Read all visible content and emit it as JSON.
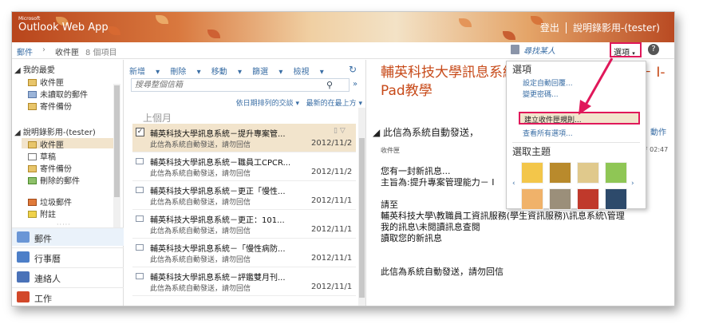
{
  "app": {
    "brand_small": "Microsoft",
    "brand_name": "Outlook Web App",
    "signout": "登出",
    "user": "說明錄影用-(tester)"
  },
  "crumbs": {
    "mail": "郵件",
    "inbox": "收件匣",
    "count": "8 個項目"
  },
  "header_links": {
    "find_people": "尋找某人",
    "options": "選項",
    "help": "?"
  },
  "leftnav": {
    "favorites_header": "我的最愛",
    "favorites": [
      {
        "label": "收件匣",
        "icon": "inbox-icon"
      },
      {
        "label": "未讀取的郵件",
        "icon": "search-folder-icon"
      },
      {
        "label": "寄件備份",
        "icon": "sent-icon"
      }
    ],
    "mailbox_header": "說明錄影用-(tester)",
    "mailbox": [
      {
        "label": "收件匣",
        "icon": "inbox-icon"
      },
      {
        "label": "草稿",
        "icon": "drafts-icon"
      },
      {
        "label": "寄件備份",
        "icon": "sent-icon"
      },
      {
        "label": "刪除的郵件",
        "icon": "trash-icon"
      },
      {
        "label": "垃圾郵件",
        "icon": "junk-icon"
      },
      {
        "label": "附註",
        "icon": "notes-icon"
      }
    ],
    "modules": [
      {
        "label": "郵件",
        "icon": "mail-icon",
        "color": "#6a96d6"
      },
      {
        "label": "行事曆",
        "icon": "calendar-icon",
        "color": "#4d7fc8"
      },
      {
        "label": "連絡人",
        "icon": "contacts-icon",
        "color": "#4a72b8"
      },
      {
        "label": "工作",
        "icon": "tasks-icon",
        "color": "#d2482a"
      }
    ]
  },
  "toolbar": {
    "new": "新增",
    "delete": "刪除",
    "move": "移動",
    "filter": "篩選",
    "view": "檢視"
  },
  "search": {
    "placeholder": "搜尋整個信箱"
  },
  "sort": {
    "by": "依日期排列的交談",
    "order": "最新的在最上方"
  },
  "list_group": "上個月",
  "messages": [
    {
      "subject": "輔英科技大學訊息系統－提升專案管...",
      "preview": "此信為系統自動發送，請勿回信",
      "date": "2012/11/2",
      "selected": true
    },
    {
      "subject": "輔英科技大學訊息系統－職員工CPCR...",
      "preview": "此信為系統自動發送，請勿回信",
      "date": "2012/11/2",
      "selected": false
    },
    {
      "subject": "輔英科技大學訊息系統－更正「慢性...",
      "preview": "此信為系統自動發送，請勿回信",
      "date": "2012/11/1",
      "selected": false
    },
    {
      "subject": "輔英科技大學訊息系統－更正：101...",
      "preview": "此信為系統自動發送，請勿回信",
      "date": "2012/11/1",
      "selected": false
    },
    {
      "subject": "輔英科技大學訊息系統－「慢性病防...",
      "preview": "此信為系統自動發送，請勿回信",
      "date": "2012/11/1",
      "selected": false
    },
    {
      "subject": "輔英科技大學訊息系統－評鑑雙月刊...",
      "preview": "此信為系統自動發送，請勿回信",
      "date": "2012/11/1",
      "selected": false
    }
  ],
  "reading": {
    "title": "輔英科技大學訊息系統－提升專案管理能力－ I-Pad教學",
    "subject": "此信為系統自動發送，",
    "actions": "動作",
    "to": "收件匣",
    "time": "F 02:47",
    "body": [
      "您有一封新訊息...",
      "主旨為:提升專案管理能力－ I",
      "",
      "請至",
      "輔英科技大學\\教職員工資訊服務(學生資訊服務)\\訊息系統\\管理",
      "我的訊息\\未閱讀訊息查閱",
      "讀取您的新訊息",
      "",
      "",
      "此信為系統自動發送，請勿回信"
    ]
  },
  "options_menu": {
    "header": "選項",
    "items": [
      "設定自動回覆...",
      "變更密碼...",
      "建立收件匣規則...",
      "查看所有選項..."
    ],
    "theme_header": "選取主題",
    "themes": [
      {
        "name": "theme-1",
        "color": "#f3c64a"
      },
      {
        "name": "theme-2",
        "color": "#b98a2c"
      },
      {
        "name": "theme-3",
        "color": "#e0c98c"
      },
      {
        "name": "theme-4",
        "color": "#8fc655"
      },
      {
        "name": "theme-5",
        "color": "#f0b26a"
      },
      {
        "name": "theme-6",
        "color": "#9b8f7a"
      },
      {
        "name": "theme-7",
        "color": "#c0392b"
      },
      {
        "name": "theme-8",
        "color": "#2d4a6b"
      }
    ]
  },
  "colors": {
    "accent": "#3a6ea5",
    "highlight": "#e0185a",
    "title": "#c74a19",
    "selected_bg": "#f2e4cc"
  }
}
